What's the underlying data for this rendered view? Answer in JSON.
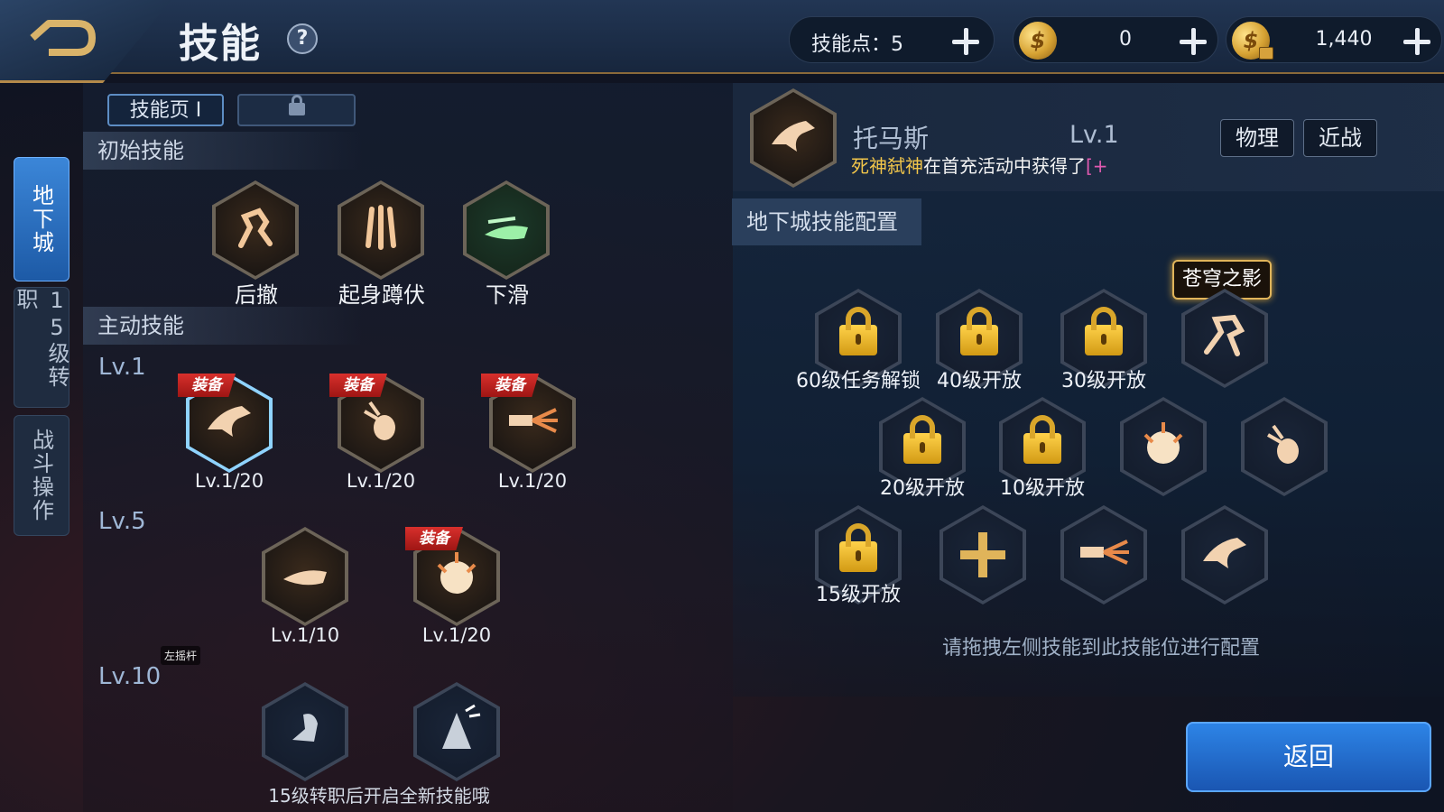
{
  "header": {
    "title": "技能",
    "skill_points_label": "技能点：5",
    "coin_amount": "0",
    "bound_coin_amount": "1,440"
  },
  "side_tabs": [
    {
      "label": "地下城",
      "active": true
    },
    {
      "label": "15级转职",
      "active": false
    },
    {
      "label": "战斗操作",
      "active": false
    }
  ],
  "skill_pages": {
    "active_label": "技能页 I"
  },
  "initial_skills": {
    "header": "初始技能",
    "items": [
      {
        "name": "后撤",
        "icon": "retreat-icon"
      },
      {
        "name": "起身蹲伏",
        "icon": "crouch-icon"
      },
      {
        "name": "下滑",
        "icon": "slide-icon"
      }
    ]
  },
  "active_skills": {
    "header": "主动技能",
    "groups": [
      {
        "level": "Lv.1",
        "skills": [
          {
            "level_text": "Lv.1/20",
            "equipped": true,
            "equip_label": "装备",
            "icon": "eagle-strike-icon"
          },
          {
            "level_text": "Lv.1/20",
            "equipped": true,
            "equip_label": "装备",
            "icon": "grenade-icon"
          },
          {
            "level_text": "Lv.1/20",
            "equipped": true,
            "equip_label": "装备",
            "icon": "rush-fire-icon"
          }
        ]
      },
      {
        "level": "Lv.5",
        "skills": [
          {
            "level_text": "Lv.1/10",
            "equipped": false,
            "icon": "slide-kick-icon"
          },
          {
            "level_text": "Lv.1/20",
            "equipped": true,
            "equip_label": "装备",
            "icon": "explosion-icon"
          }
        ]
      },
      {
        "level": "Lv.10",
        "skills": [
          {
            "icon": "fist-icon"
          },
          {
            "icon": "claw-burst-icon"
          }
        ]
      }
    ],
    "bottom_hint": "15级转职后开启全新技能哦",
    "stick_label": "左摇杆"
  },
  "hero": {
    "name": "托马斯",
    "level": "Lv.1",
    "notice_gold": "死神弑神",
    "notice_text": "在首充活动中获得了",
    "notice_pink": "[+",
    "attr_type": "物理",
    "attr_range": "近战"
  },
  "config": {
    "header": "地下城技能配置",
    "skin_badge": "苍穹之影",
    "slots": [
      {
        "label": "60级任务解锁",
        "locked": true
      },
      {
        "label": "40级开放",
        "locked": true
      },
      {
        "label": "30级开放",
        "locked": true
      },
      {
        "label": "",
        "locked": false,
        "icon": "shadow-strike-icon"
      },
      {
        "label": "20级开放",
        "locked": true
      },
      {
        "label": "10级开放",
        "locked": true
      },
      {
        "label": "",
        "locked": false,
        "icon": "explosion-icon"
      },
      {
        "label": "",
        "locked": false,
        "icon": "grenade-icon"
      },
      {
        "label": "15级开放",
        "locked": true
      },
      {
        "label": "",
        "locked": false,
        "icon": "add-icon"
      },
      {
        "label": "",
        "locked": false,
        "icon": "rush-fire-icon"
      },
      {
        "label": "",
        "locked": false,
        "icon": "eagle-strike-icon"
      }
    ],
    "hint": "请拖拽左侧技能到此技能位进行配置"
  },
  "return_label": "返回",
  "colors": {
    "accent_blue": "#2d84e6",
    "gold": "#e0b45a",
    "equip_red": "#d8302c"
  }
}
